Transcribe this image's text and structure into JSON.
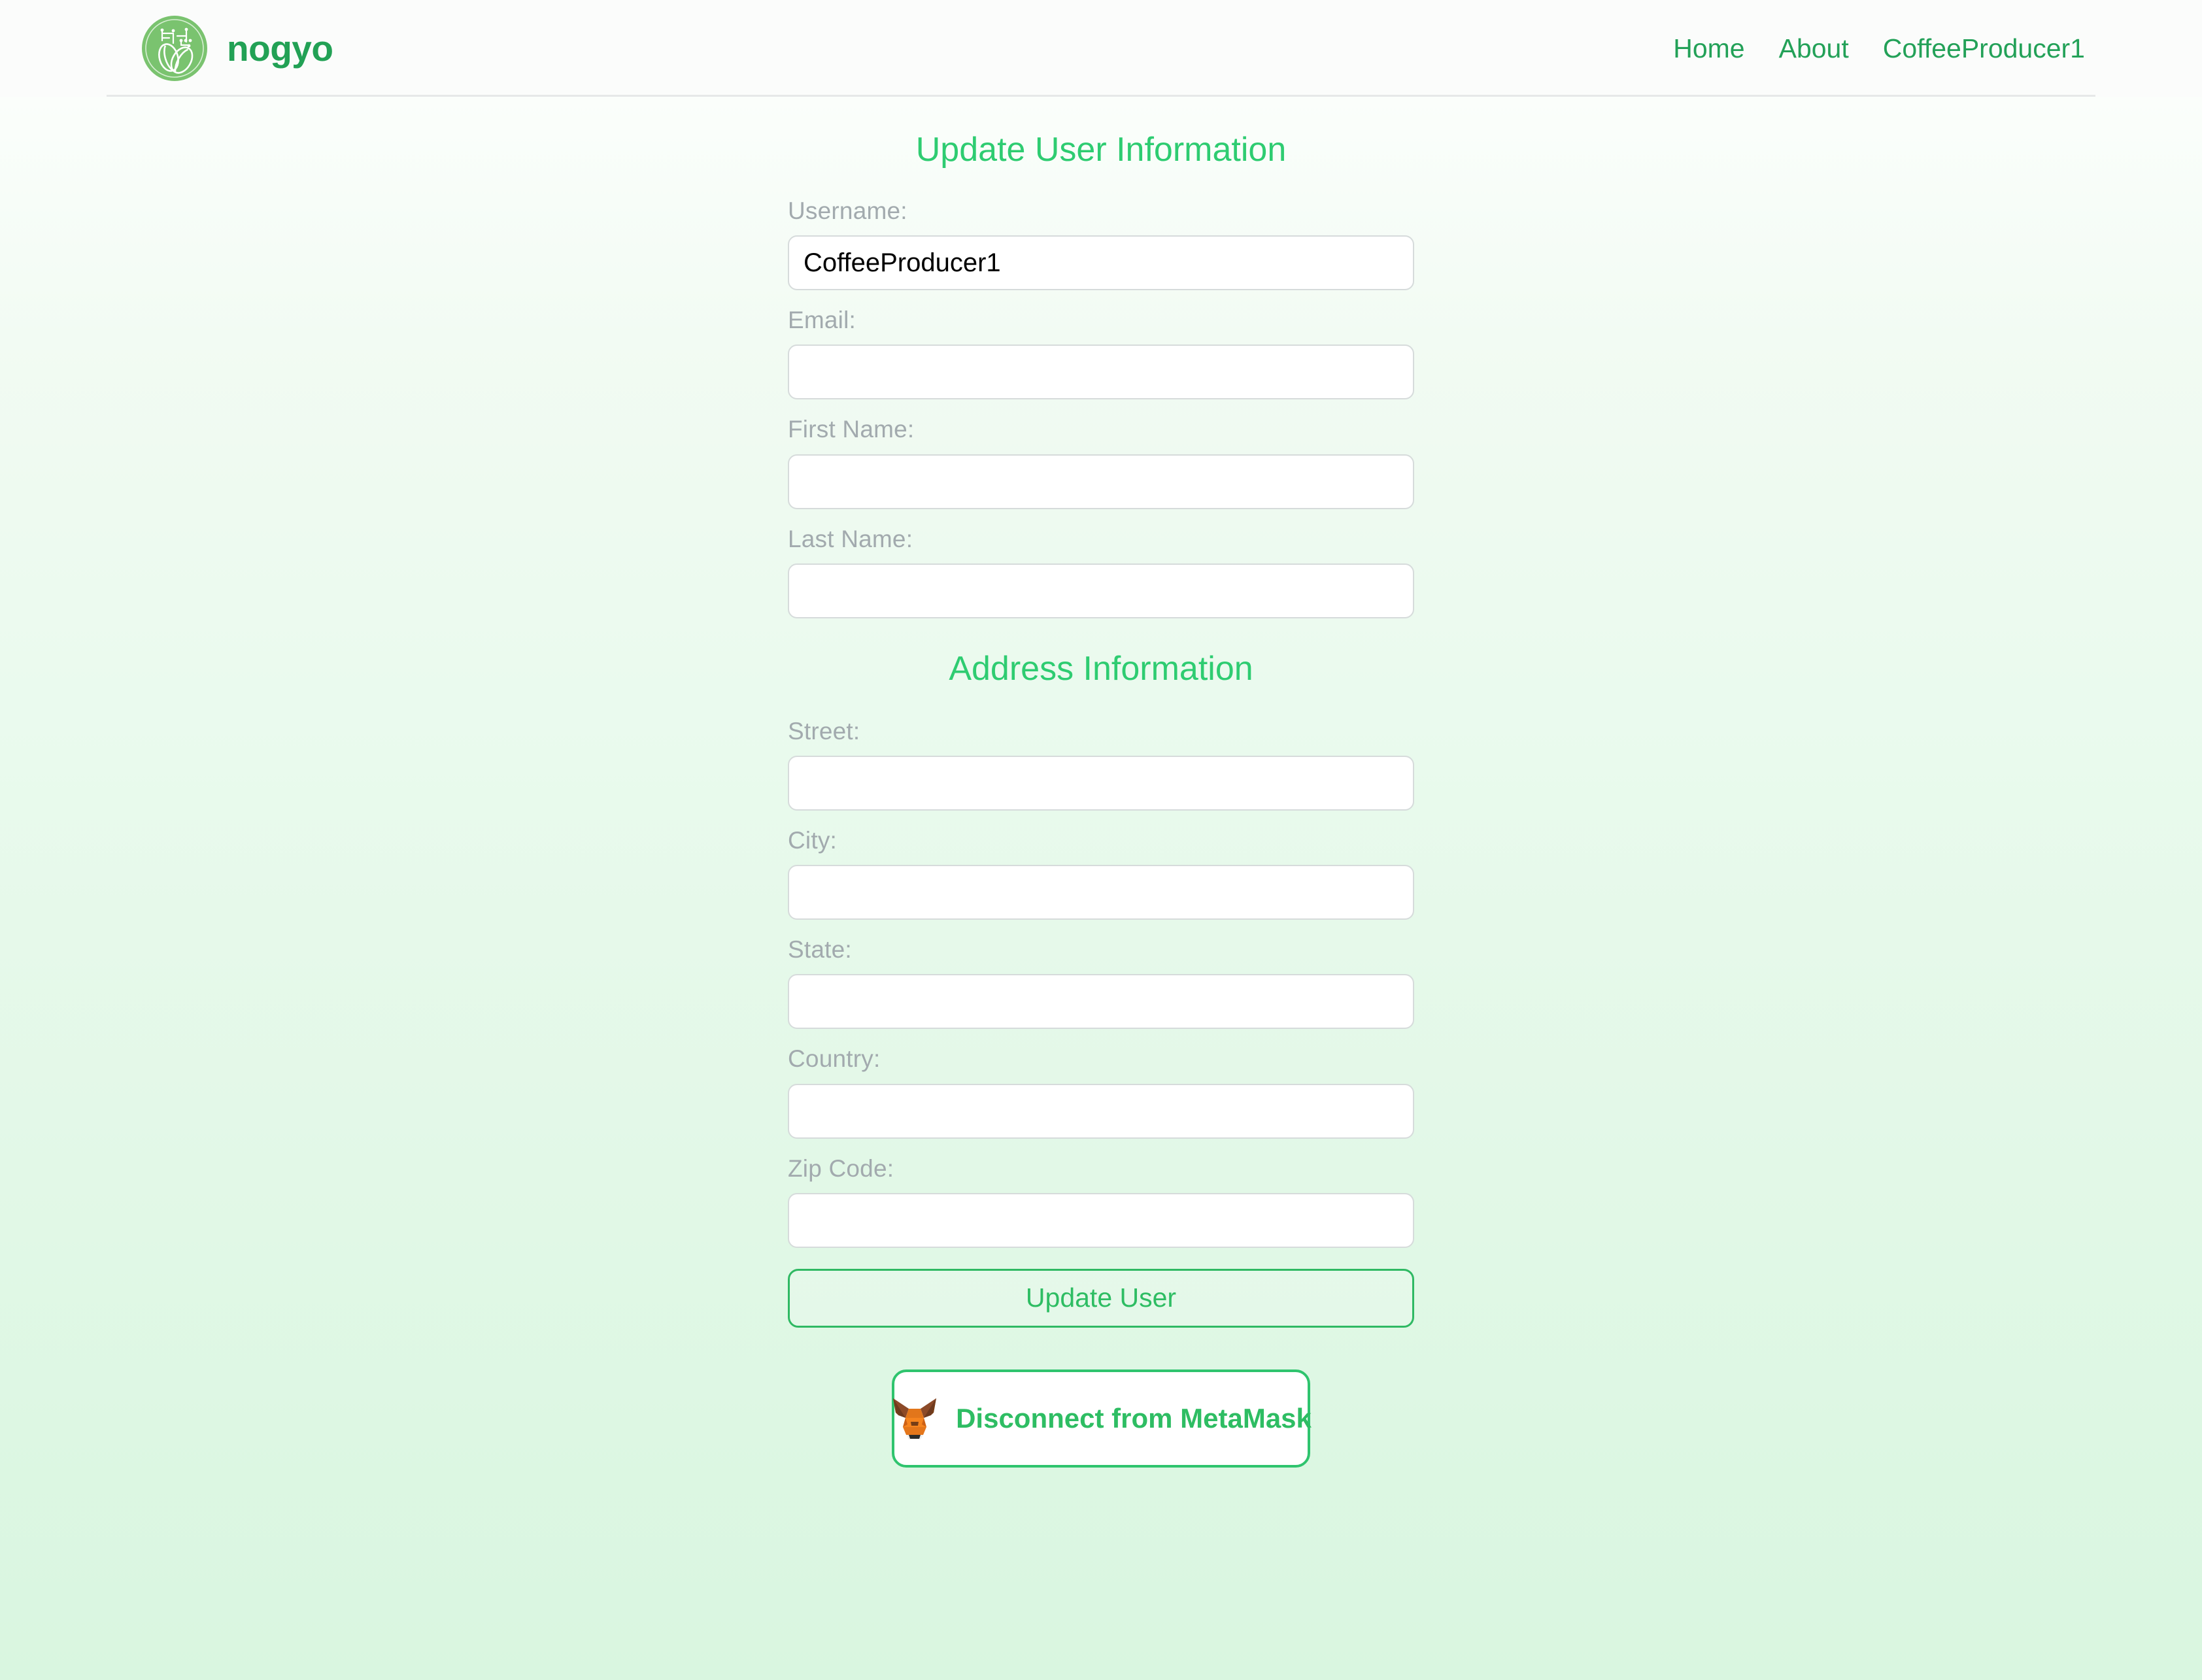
{
  "header": {
    "brand": {
      "name": "nogyo",
      "logo_icon": "coffee-bean-circuit-logo-icon",
      "logo_color": "#7ac36f"
    },
    "nav": [
      {
        "label": "Home"
      },
      {
        "label": "About"
      },
      {
        "label": "CoffeeProducer1"
      }
    ],
    "nav_color": "#23a158"
  },
  "main": {
    "user_section": {
      "title": "Update User Information",
      "title_color": "#2ecc71",
      "fields": [
        {
          "label": "Username:",
          "value": "CoffeeProducer1",
          "placeholder": ""
        },
        {
          "label": "Email:",
          "value": "",
          "placeholder": ""
        },
        {
          "label": "First Name:",
          "value": "",
          "placeholder": ""
        },
        {
          "label": "Last Name:",
          "value": "",
          "placeholder": ""
        }
      ]
    },
    "address_section": {
      "title": "Address Information",
      "title_color": "#2ecc71",
      "fields": [
        {
          "label": "Street:",
          "value": "",
          "placeholder": ""
        },
        {
          "label": "City:",
          "value": "",
          "placeholder": ""
        },
        {
          "label": "State:",
          "value": "",
          "placeholder": ""
        },
        {
          "label": "Country:",
          "value": "",
          "placeholder": ""
        },
        {
          "label": "Zip Code:",
          "value": "",
          "placeholder": ""
        }
      ]
    },
    "submit_label": "Update User",
    "submit_color": "#2ebd63"
  },
  "wallet": {
    "label": "Disconnect from MetaMask",
    "icon": "metamask-fox-icon",
    "label_color": "#2ebd63",
    "border_color": "#2fc46e"
  }
}
